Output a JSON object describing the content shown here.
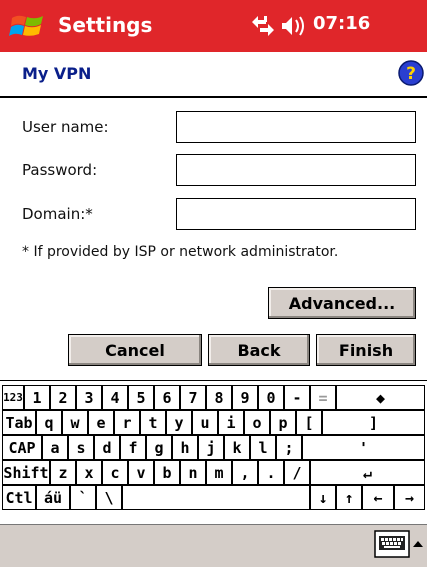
{
  "titlebar": {
    "app_title": "Settings",
    "clock": "07:16",
    "icons": [
      "windows-start-icon",
      "connectivity-icon",
      "speaker-icon"
    ]
  },
  "page": {
    "title": "My VPN",
    "help_icon": "help-icon"
  },
  "form": {
    "username_label": "User name:",
    "username_value": "",
    "password_label": "Password:",
    "password_value": "",
    "domain_label": "Domain:*",
    "domain_value": "",
    "footnote": "* If provided by ISP or network administrator."
  },
  "buttons": {
    "advanced": "Advanced...",
    "cancel": "Cancel",
    "back": "Back",
    "finish": "Finish"
  },
  "keyboard": {
    "rows": [
      [
        "123",
        "1",
        "2",
        "3",
        "4",
        "5",
        "6",
        "7",
        "8",
        "9",
        "0",
        "-",
        "=",
        "◆"
      ],
      [
        "Tab",
        "q",
        "w",
        "e",
        "r",
        "t",
        "y",
        "u",
        "i",
        "o",
        "p",
        "[",
        "]"
      ],
      [
        "CAP",
        "a",
        "s",
        "d",
        "f",
        "g",
        "h",
        "j",
        "k",
        "l",
        ";",
        "'"
      ],
      [
        "Shift",
        "z",
        "x",
        "c",
        "v",
        "b",
        "n",
        "m",
        ",",
        ".",
        "/",
        "↵"
      ],
      [
        "Ctl",
        "áü",
        "`",
        "\\",
        "",
        "↓",
        "↑",
        "←",
        "→"
      ]
    ]
  },
  "menubar": {
    "sip_icon": "keyboard-icon",
    "sip_arrow_icon": "caret-up-icon"
  },
  "colors": {
    "titlebar": "#e0262a",
    "page_title": "#0a1f8a",
    "button_face": "#d4cdc8",
    "menubar": "#d4cdc8"
  }
}
